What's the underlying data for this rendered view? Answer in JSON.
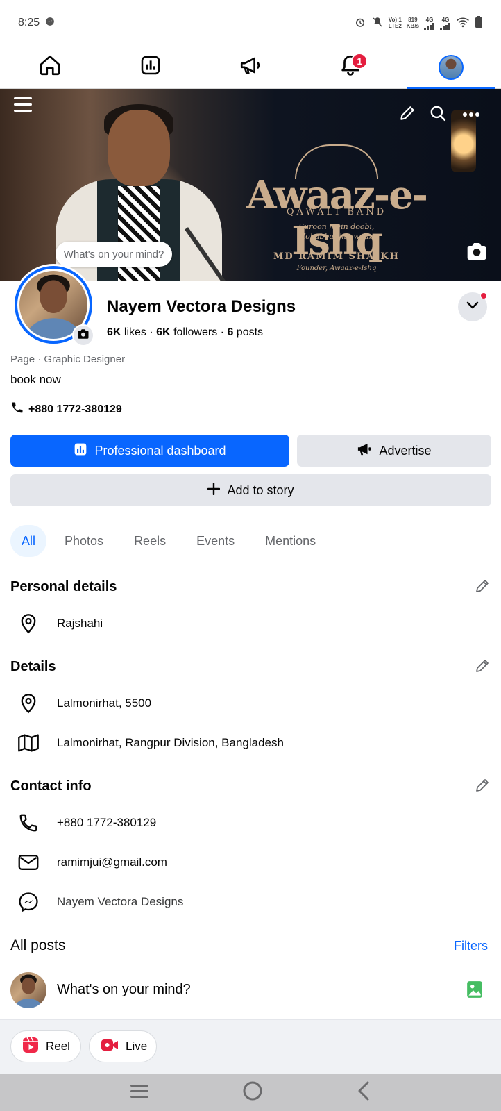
{
  "status_bar": {
    "time": "8:25",
    "network_top": "Vo) 1",
    "network_bottom": "LTE2",
    "speed_top": "819",
    "speed_bottom": "KB/s",
    "sig1": "4G",
    "sig2": "4G"
  },
  "top_nav": {
    "items": [
      "home-icon",
      "dashboard-icon",
      "megaphone-icon",
      "bell-icon",
      "profile-avatar"
    ],
    "notification_count": "1",
    "active": "profile"
  },
  "cover": {
    "title": "Awaaz-e-Ishq",
    "subtitle": "QAWALI BAND",
    "quote_line1": "Suroon mein doobi,",
    "quote_line2": "Mohabbat ki awaaz.",
    "name": "MD RAMIM SHAIKH",
    "role": "Founder, Awaaz-e-Ishq",
    "mind_prompt": "What's on your mind?"
  },
  "profile": {
    "name": "Nayem Vectora Designs",
    "likes_count": "6K",
    "likes_label": "likes",
    "followers_count": "6K",
    "followers_label": "followers",
    "posts_count": "6",
    "posts_label": "posts",
    "dot": "·",
    "category": "Page · Graphic Designer",
    "bio": "book now",
    "phone": "+880 1772-380129"
  },
  "actions": {
    "dashboard": "Professional dashboard",
    "advertise": "Advertise",
    "add_story": "Add to story"
  },
  "tabs": [
    {
      "label": "All",
      "active": true
    },
    {
      "label": "Photos",
      "active": false
    },
    {
      "label": "Reels",
      "active": false
    },
    {
      "label": "Events",
      "active": false
    },
    {
      "label": "Mentions",
      "active": false
    }
  ],
  "personal_details": {
    "title": "Personal details",
    "location": "Rajshahi"
  },
  "details": {
    "title": "Details",
    "address": "Lalmonirhat, 5500",
    "region": "Lalmonirhat, Rangpur Division, Bangladesh"
  },
  "contact_info": {
    "title": "Contact info",
    "phone": "+880 1772-380129",
    "email": "ramimjui@gmail.com",
    "messenger": "Nayem Vectora Designs"
  },
  "posts": {
    "title": "All posts",
    "filters": "Filters",
    "composer_prompt": "What's on your mind?"
  },
  "create": {
    "reel": "Reel",
    "live": "Live"
  },
  "colors": {
    "accent": "#0866ff",
    "badge": "#e41e3f",
    "muted": "#65676b",
    "button_gray": "#e4e6eb"
  }
}
